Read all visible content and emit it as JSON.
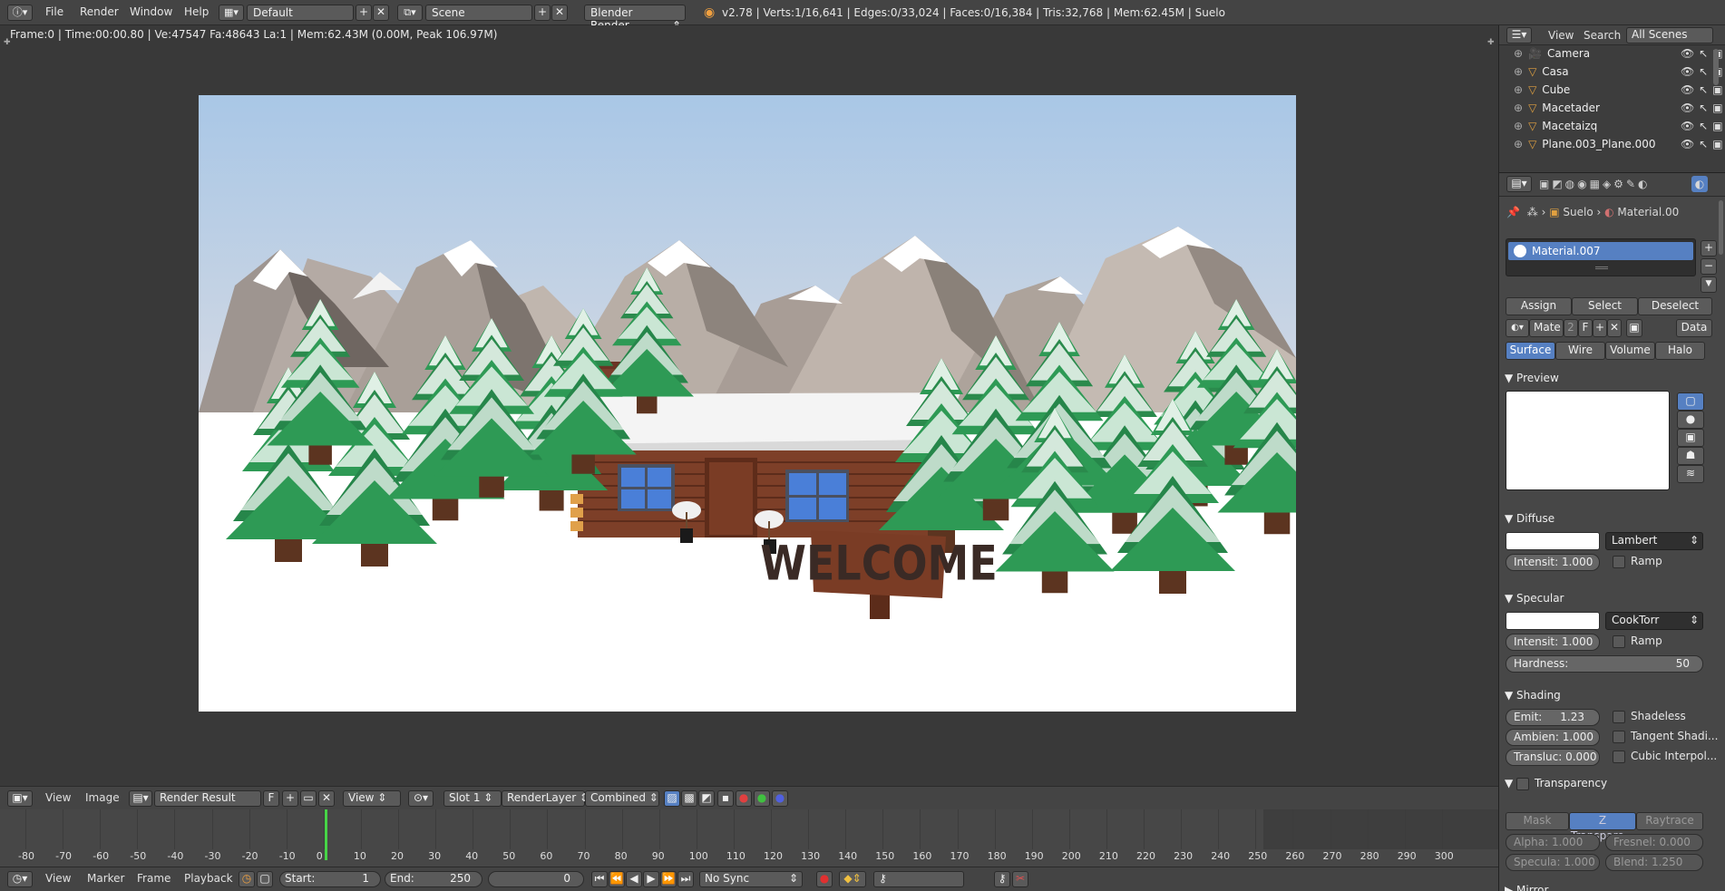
{
  "header": {
    "menus": [
      "File",
      "Render",
      "Window",
      "Help"
    ],
    "layout": "Default",
    "scene": "Scene",
    "engine": "Blender Render",
    "stats": "v2.78 | Verts:1/16,641 | Edges:0/33,024 | Faces:0/16,384 | Tris:32,768 | Mem:62.45M | Suelo"
  },
  "viewport": {
    "frame_info": "Frame:0 | Time:00:00.80 | Ve:47547 Fa:48643 La:1 | Mem:62.43M (0.00M, Peak 106.97M)",
    "sign_text": "WELCOME"
  },
  "image_editor": {
    "view": "View",
    "image": "Image",
    "image_name": "Render Result",
    "fake_flag": "F",
    "view_select": "View",
    "slot": "Slot 1",
    "render_layer": "RenderLayer",
    "pass": "Combined"
  },
  "timeline": {
    "ticks": [
      "-80",
      "-70",
      "-60",
      "-50",
      "-40",
      "-30",
      "-20",
      "-10",
      "0",
      "10",
      "20",
      "30",
      "40",
      "50",
      "60",
      "70",
      "80",
      "90",
      "100",
      "110",
      "120",
      "130",
      "140",
      "150",
      "160",
      "170",
      "180",
      "190",
      "200",
      "210",
      "220",
      "230",
      "240",
      "250",
      "260",
      "270",
      "280",
      "290",
      "300"
    ],
    "menus": [
      "View",
      "Marker",
      "Frame",
      "Playback"
    ],
    "start_label": "Start:",
    "start": "1",
    "end_label": "End:",
    "end": "250",
    "current": "0",
    "sync": "No Sync"
  },
  "outliner": {
    "menus": [
      "View",
      "Search"
    ],
    "filter": "All Scenes",
    "items": [
      "Camera",
      "Casa",
      "Cube",
      "Macetader",
      "Macetaizq",
      "Plane.003_Plane.000"
    ]
  },
  "properties": {
    "breadcrumb": [
      "Suelo",
      "Material.00"
    ],
    "material_slot": "Material.007",
    "assign": "Assign",
    "select": "Select",
    "deselect": "Deselect",
    "mat_name": "Mate",
    "users": "2",
    "fake": "F",
    "data": "Data",
    "tabs": [
      "Surface",
      "Wire",
      "Volume",
      "Halo"
    ],
    "preview_title": "Preview",
    "diffuse": {
      "title": "Diffuse",
      "shader": "Lambert",
      "intensity": "Intensit: 1.000",
      "ramp": "Ramp"
    },
    "specular": {
      "title": "Specular",
      "shader": "CookTorr",
      "intensity": "Intensit: 1.000",
      "ramp": "Ramp",
      "hardness_label": "Hardness:",
      "hardness": "50"
    },
    "shading": {
      "title": "Shading",
      "emit_label": "Emit:",
      "emit": "1.23",
      "ambient": "Ambien: 1.000",
      "translucency": "Transluc: 0.000",
      "shadeless": "Shadeless",
      "tangent": "Tangent Shadi...",
      "cubic": "Cubic Interpol..."
    },
    "transparency": {
      "title": "Transparency",
      "modes": [
        "Mask",
        "Z Transpare...",
        "Raytrace"
      ],
      "alpha": "Alpha: 1.000",
      "fresnel": "Fresnel: 0.000",
      "specular": "Specula: 1.000",
      "blend": "Blend: 1.250"
    },
    "mirror": "Mirror"
  },
  "colors": {
    "accent": "#5680c2",
    "playhead": "#47d447",
    "timeline": "#474747"
  }
}
